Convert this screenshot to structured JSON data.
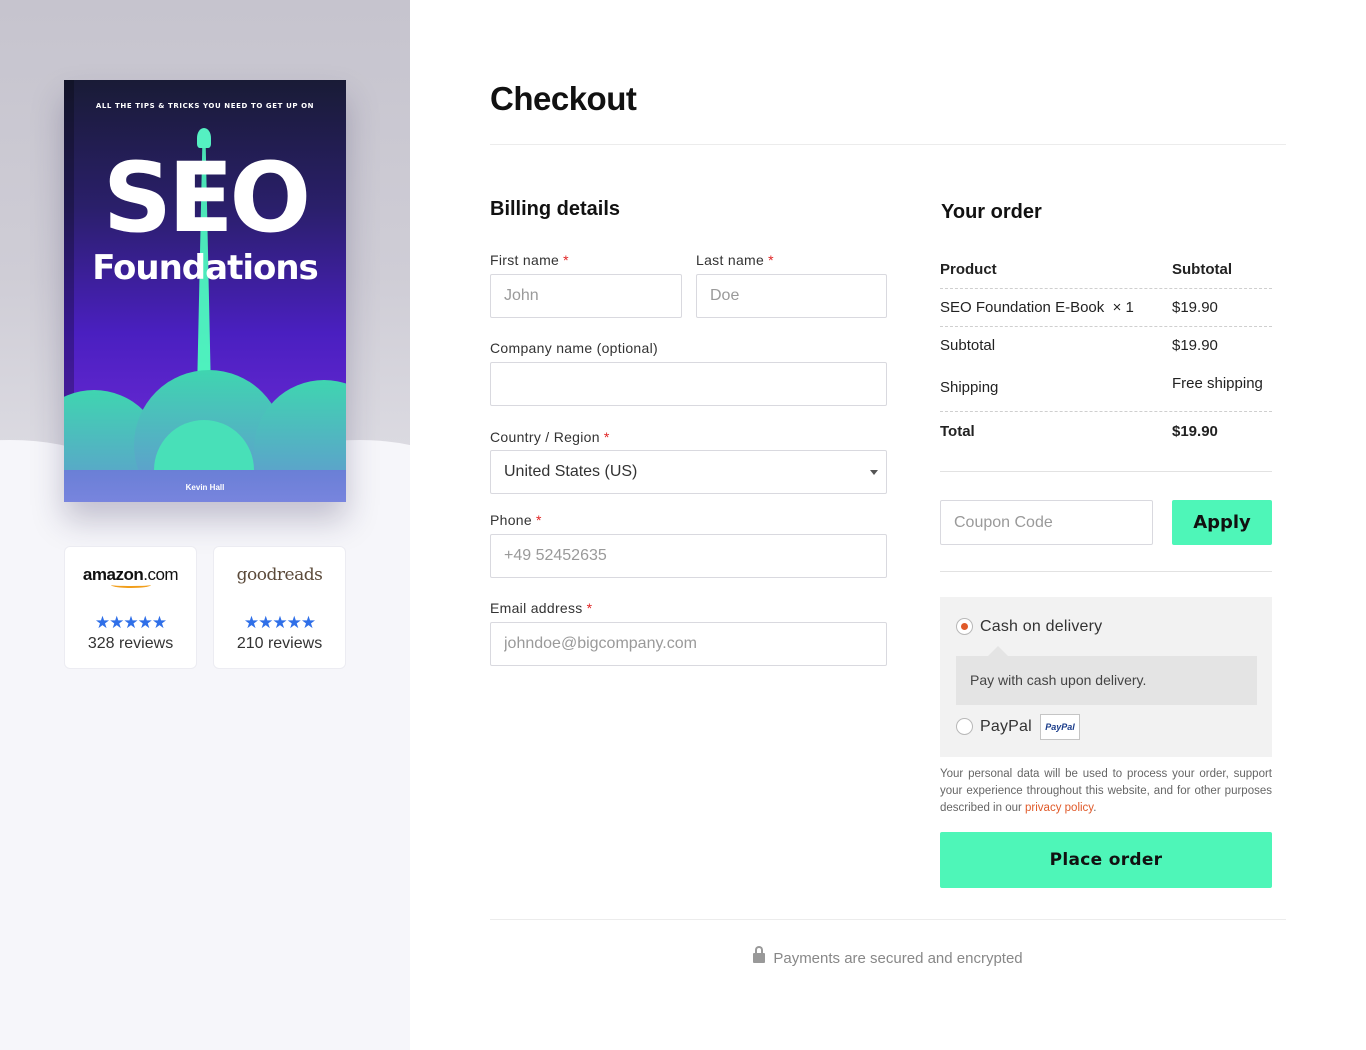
{
  "book": {
    "tagline": "ALL THE TIPS & TRICKS YOU NEED TO GET UP ON",
    "title_line1": "SEO",
    "title_line2": "Foundations",
    "author": "Kevin Hall"
  },
  "reviews": [
    {
      "source": "amazon.com",
      "brand_main": "amazon",
      "brand_suffix": ".com",
      "rating": 5,
      "stars": "★★★★★",
      "count_text": "328 reviews"
    },
    {
      "source": "goodreads",
      "brand_main": "goodreads",
      "brand_suffix": "",
      "rating": 5,
      "stars": "★★★★★",
      "count_text": "210 reviews"
    }
  ],
  "page": {
    "title": "Checkout"
  },
  "billing": {
    "title": "Billing details",
    "required_marker": "*",
    "first_name": {
      "label": "First name",
      "placeholder": "John"
    },
    "last_name": {
      "label": "Last name",
      "placeholder": "Doe"
    },
    "company": {
      "label": "Company name (optional)",
      "placeholder": ""
    },
    "country": {
      "label": "Country / Region",
      "value": "United States (US)"
    },
    "phone": {
      "label": "Phone",
      "placeholder": "+49 52452635"
    },
    "email": {
      "label": "Email address",
      "placeholder": "johndoe@bigcompany.com"
    }
  },
  "order": {
    "title": "Your order",
    "headers": {
      "product": "Product",
      "subtotal": "Subtotal"
    },
    "item": {
      "name": "SEO Foundation E-Book",
      "qty": "× 1",
      "price": "$19.90"
    },
    "subtotal": {
      "label": "Subtotal",
      "value": "$19.90"
    },
    "shipping": {
      "label": "Shipping",
      "value": "Free shipping"
    },
    "total": {
      "label": "Total",
      "value": "$19.90"
    }
  },
  "coupon": {
    "placeholder": "Coupon Code",
    "apply_label": "Apply"
  },
  "payment": {
    "cod": {
      "label": "Cash on delivery",
      "description": "Pay with cash upon delivery.",
      "selected": true
    },
    "paypal": {
      "label": "PayPal",
      "logo_text": "PayPal",
      "selected": false
    }
  },
  "privacy": {
    "text": "Your personal data will be used to process your order, support your experience throughout this website, and for other purposes described in our ",
    "link_text": "privacy policy",
    "end": "."
  },
  "place_order_label": "Place order",
  "secure_text": "Payments are secured and encrypted",
  "colors": {
    "accent": "#4ef6b8",
    "required": "#e02424",
    "link": "#e05a2a",
    "stars": "#2f6fe8"
  }
}
